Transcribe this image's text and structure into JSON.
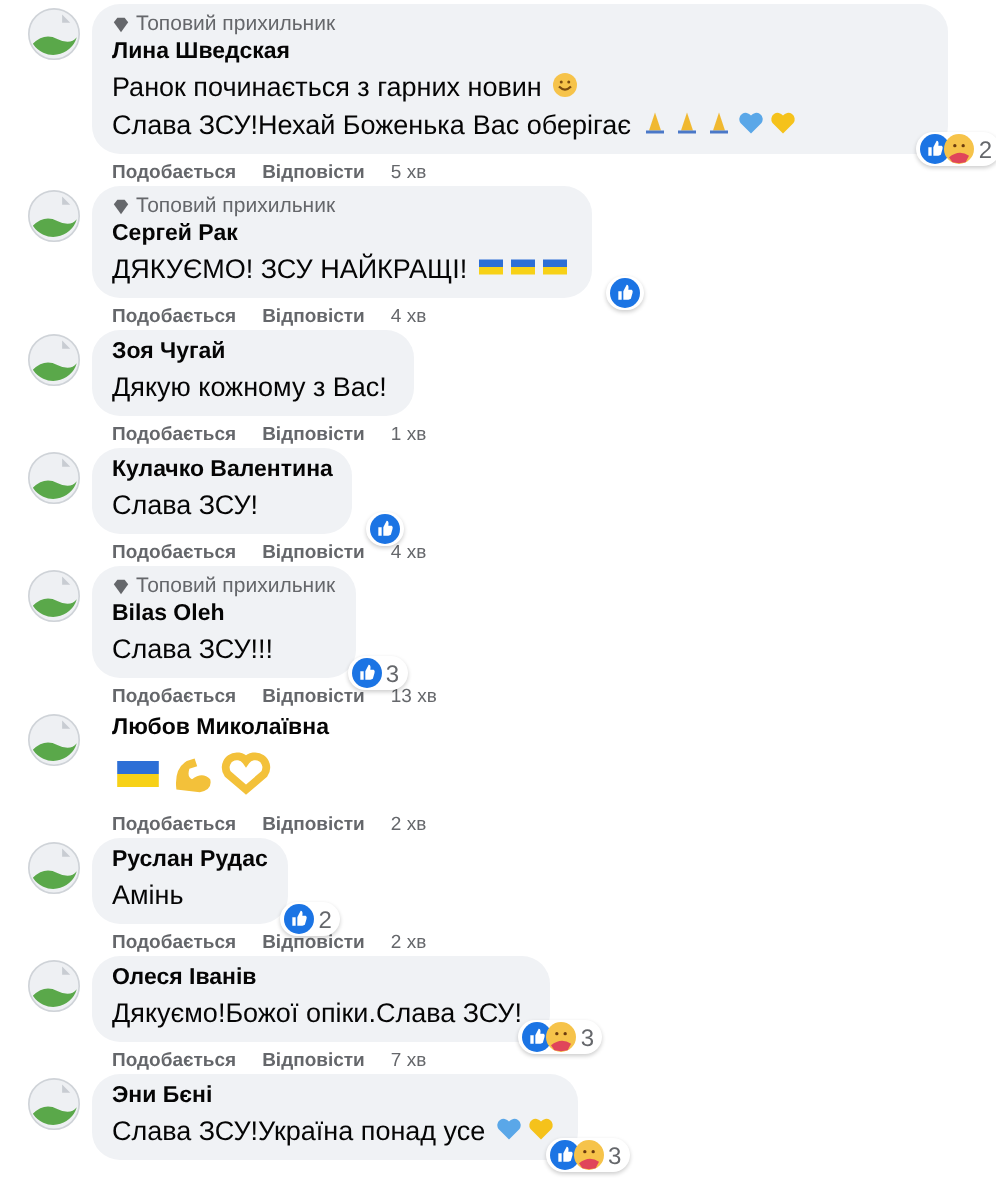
{
  "comments": [
    {
      "badge": "Топовий прихильник",
      "author": "Лина Шведская",
      "kind": "bubble",
      "message": [
        {
          "kind": "text",
          "text": "Ранок починається з гарних новин"
        },
        {
          "kind": "smile"
        },
        {
          "kind": "text",
          "text": "Слава ЗСУ!Нехай Боженька"
        },
        {
          "kind": "text",
          "text": "Вас оберігає"
        },
        {
          "kind": "pray"
        },
        {
          "kind": "pray"
        },
        {
          "kind": "pray"
        },
        {
          "kind": "heart-blue"
        },
        {
          "kind": "heart-yellow"
        }
      ],
      "reactions": {
        "items": [
          {
            "kind": "like"
          },
          {
            "kind": "care"
          }
        ],
        "count": "2"
      },
      "like": "Подобається",
      "reply": "Відповісти",
      "time": "5 хв"
    },
    {
      "badge": "Топовий прихильник",
      "author": "Сергей Рак",
      "kind": "bubble",
      "message": [
        {
          "kind": "text",
          "text": "ДЯКУЄМО!  ЗСУ НАЙКРАЩІ!  "
        },
        {
          "kind": "flag"
        },
        {
          "kind": "flag"
        },
        {
          "kind": "flag"
        }
      ],
      "reactions": {
        "items": [
          {
            "kind": "like"
          }
        ]
      },
      "like": "Подобається",
      "reply": "Відповісти",
      "time": "4 хв"
    },
    {
      "author": "Зоя Чугай",
      "kind": "bubble",
      "message": [
        {
          "kind": "text",
          "text": "Дякую кожному з Вас!"
        }
      ],
      "like": "Подобається",
      "reply": "Відповісти",
      "time": "1 хв"
    },
    {
      "author": "Кулачко Валентина",
      "kind": "bubble",
      "message": [
        {
          "kind": "text",
          "text": "Слава ЗСУ!"
        }
      ],
      "reactions": {
        "items": [
          {
            "kind": "like"
          }
        ]
      },
      "like": "Подобається",
      "reply": "Відповісти",
      "time": "4 хв"
    },
    {
      "badge": "Топовий прихильник",
      "author": "Bilas Oleh",
      "kind": "bubble",
      "message": [
        {
          "kind": "text",
          "text": "Слава ЗСУ!!!"
        }
      ],
      "reactions": {
        "items": [
          {
            "kind": "like"
          }
        ],
        "count": "3"
      },
      "like": "Подобається",
      "reply": "Відповісти",
      "time": "13 хв"
    },
    {
      "author": "Любов Миколаївна",
      "kind": "bare",
      "message": [
        {
          "kind": "flag"
        },
        {
          "kind": "muscle"
        },
        {
          "kind": "heart-hands"
        }
      ],
      "like": "Подобається",
      "reply": "Відповісти",
      "time": "2 хв"
    },
    {
      "author": "Руслан Рудас",
      "kind": "bubble",
      "message": [
        {
          "kind": "text",
          "text": "Амінь"
        }
      ],
      "reactions": {
        "items": [
          {
            "kind": "like"
          }
        ],
        "count": "2"
      },
      "like": "Подобається",
      "reply": "Відповісти",
      "time": "2 хв"
    },
    {
      "author": "Олеся Іванів",
      "kind": "bubble",
      "message": [
        {
          "kind": "text",
          "text": "Дякуємо!Божої опіки.Слава ЗСУ!"
        }
      ],
      "reactions": {
        "items": [
          {
            "kind": "like"
          },
          {
            "kind": "care"
          }
        ],
        "count": "3"
      },
      "like": "Подобається",
      "reply": "Відповісти",
      "time": "7 хв"
    },
    {
      "author": "Эни Бєні",
      "kind": "bubble",
      "message": [
        {
          "kind": "text",
          "text": "Слава ЗСУ!Україна понад усе"
        },
        {
          "kind": "heart-blue"
        },
        {
          "kind": "heart-yellow"
        }
      ],
      "reactions": {
        "items": [
          {
            "kind": "like"
          },
          {
            "kind": "care"
          }
        ],
        "count": "3"
      }
    }
  ]
}
